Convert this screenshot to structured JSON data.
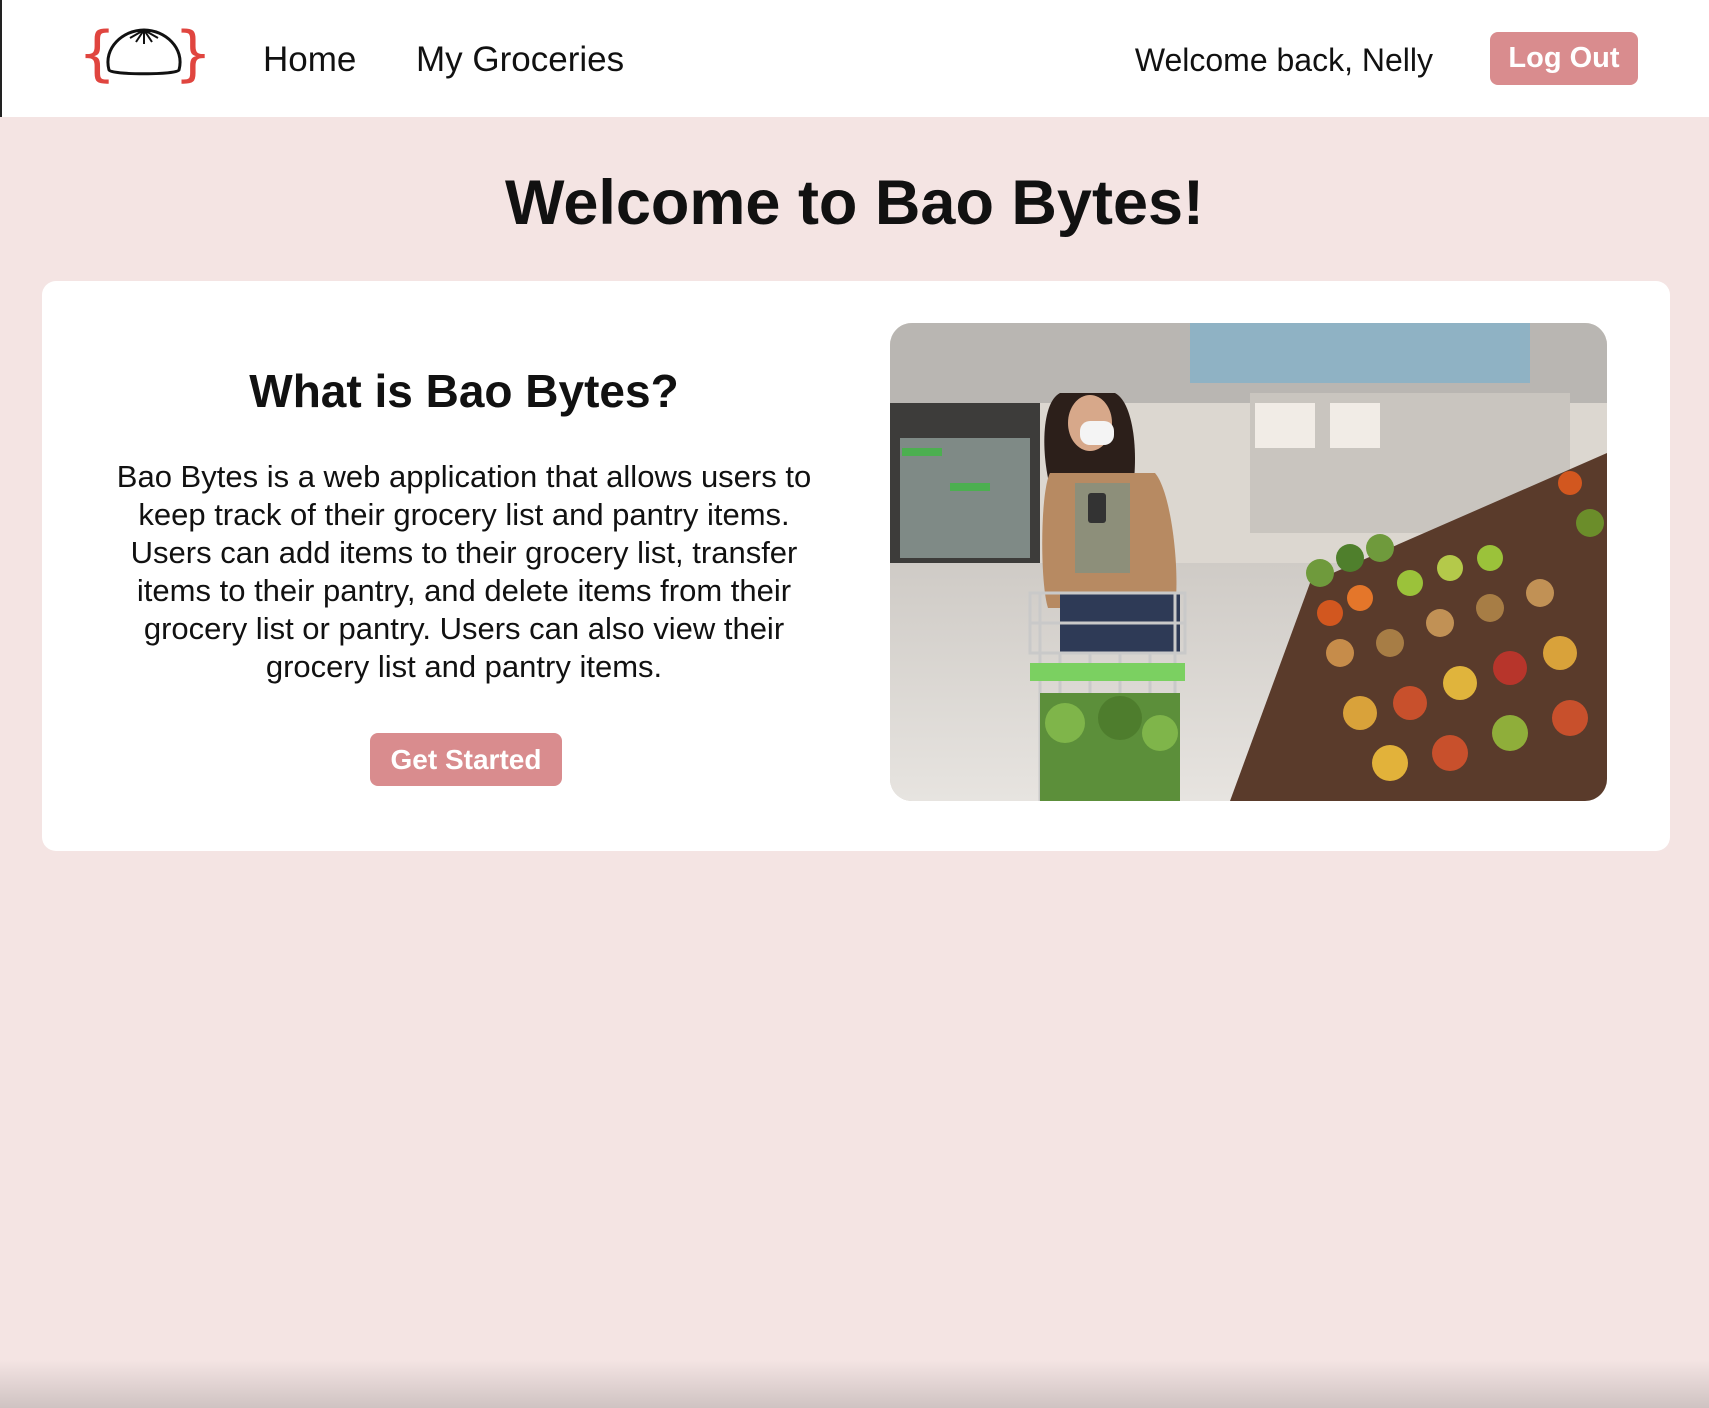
{
  "nav": {
    "logo": "bao-bytes-logo",
    "links": [
      "Home",
      "My Groceries"
    ],
    "welcome": "Welcome back, Nelly",
    "logout_label": "Log Out"
  },
  "main": {
    "title": "Welcome to Bao Bytes!",
    "card": {
      "heading": "What is Bao Bytes?",
      "body": "Bao Bytes is a web application that allows users to keep track of their grocery list and pantry items. Users can add items to their grocery list, transfer items to their pantry, and delete items from their grocery list or pantry. Users can also view their grocery list and pantry items.",
      "cta_label": "Get Started",
      "image": "grocery-shopper-photo"
    }
  },
  "colors": {
    "page_background": "#f4e4e3",
    "button": "#d98c8e",
    "logo_braces": "#e0453f"
  }
}
